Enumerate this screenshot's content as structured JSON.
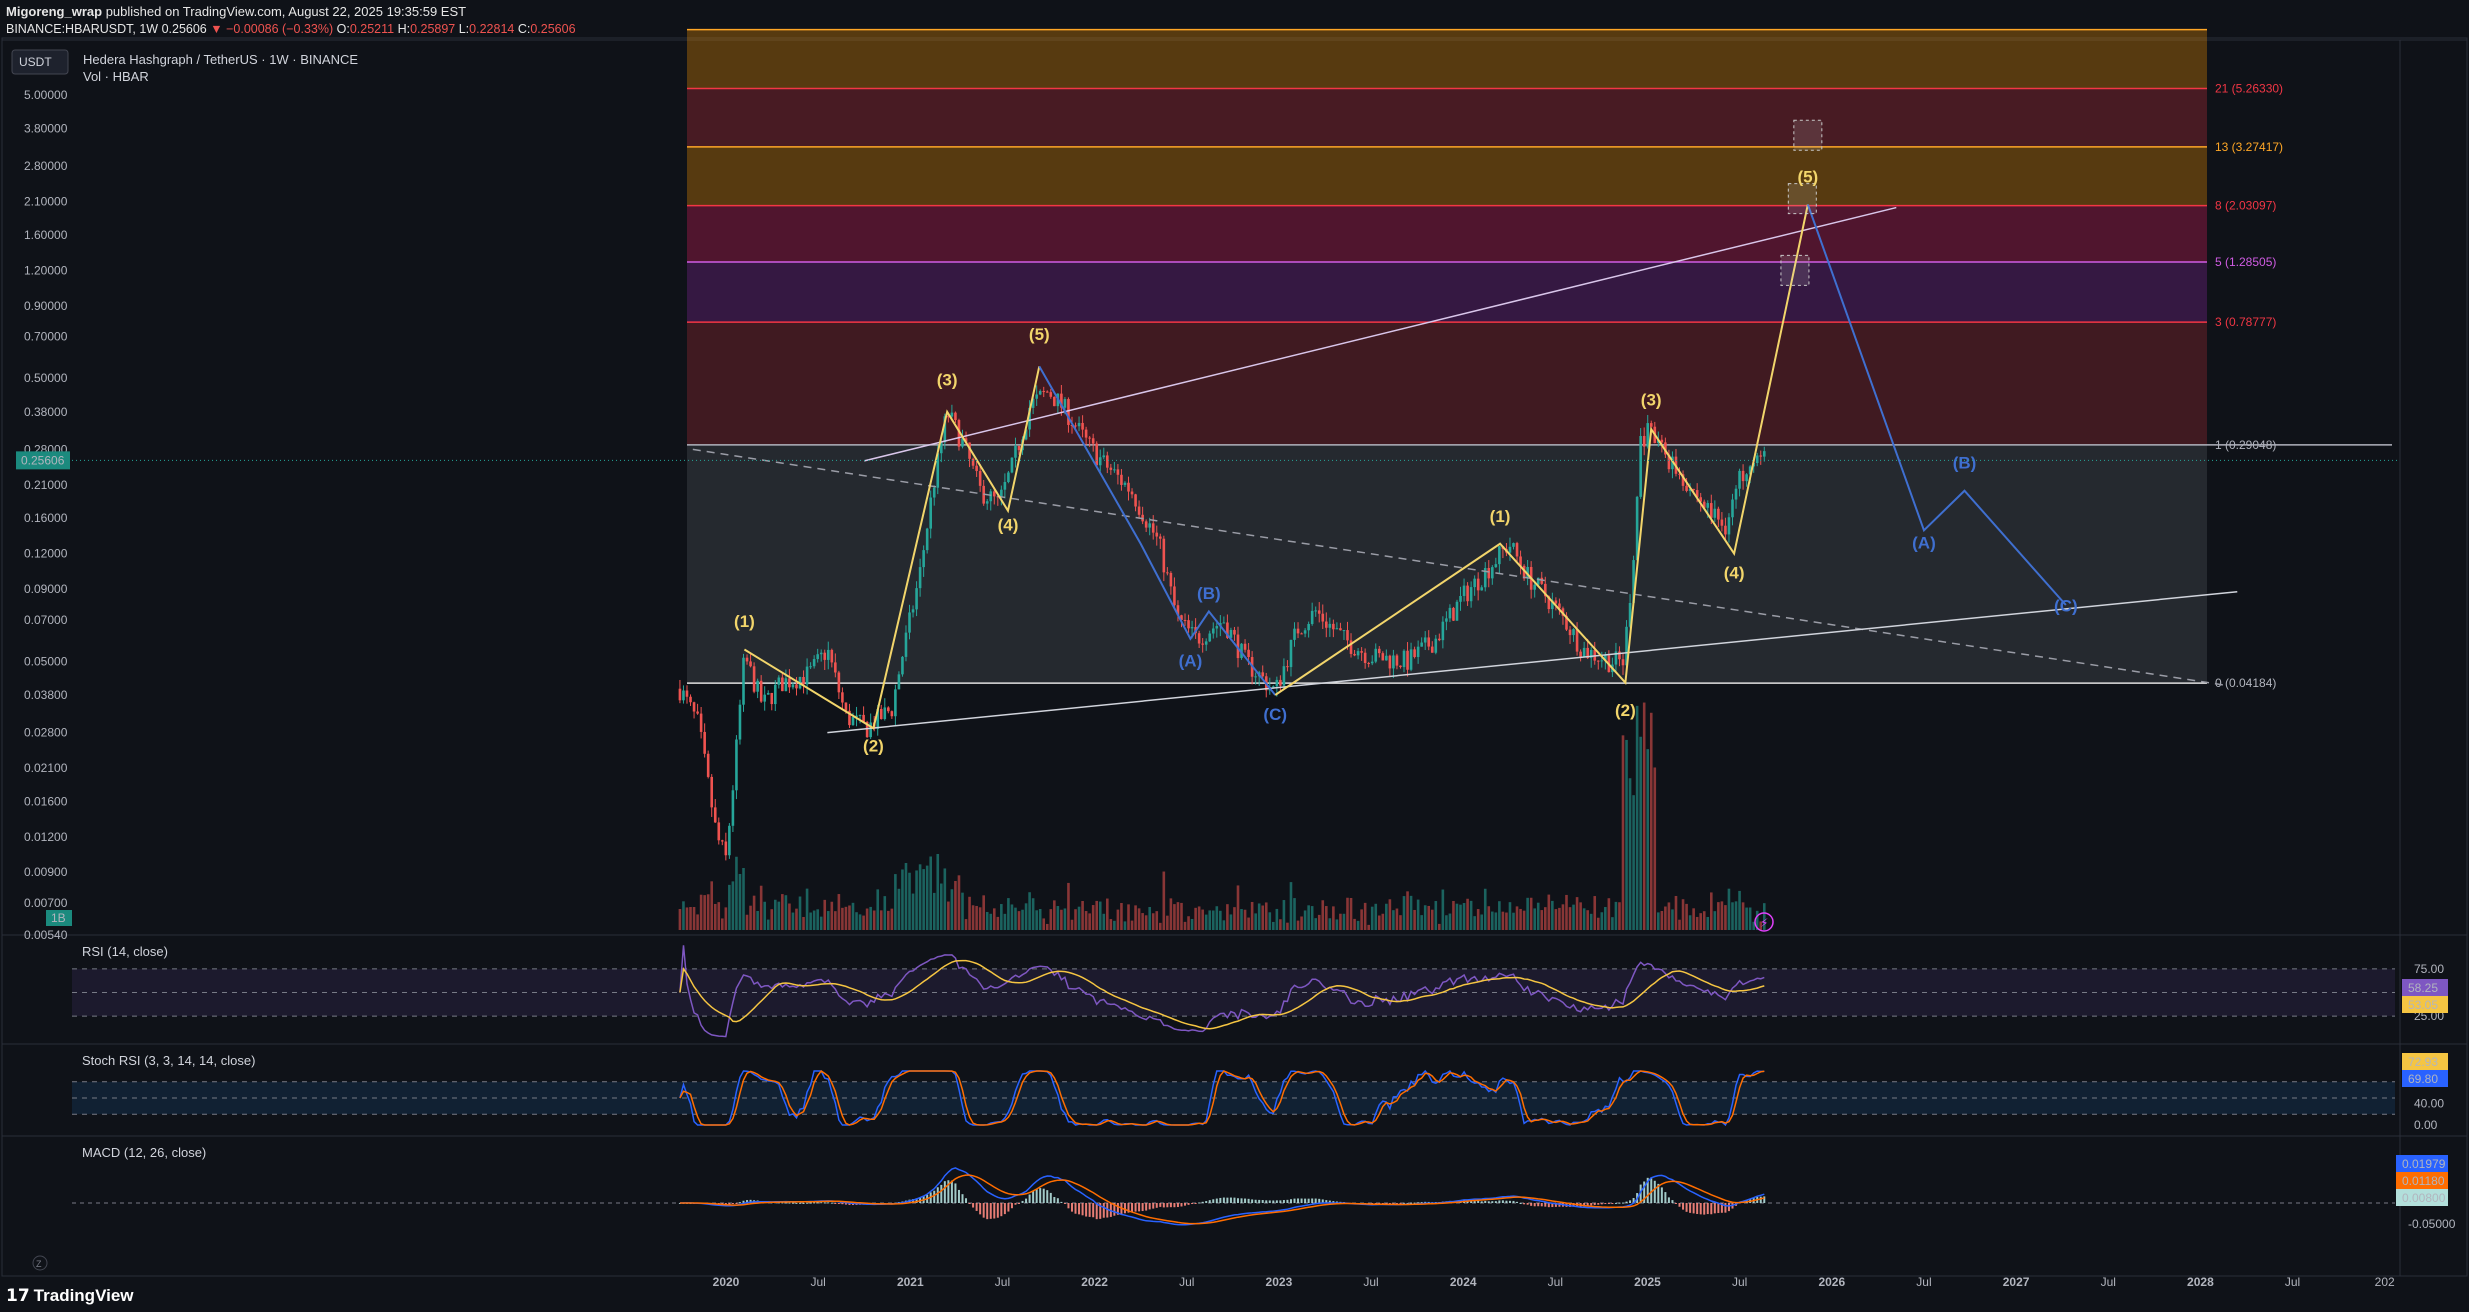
{
  "header": {
    "author": "Migoreng_wrap",
    "published_text": " published on TradingView.com, August 22, 2025 19:35:59 EST",
    "symbol_line": "BINANCE:HBARUSDT, 1W 0.25606",
    "change_text": "▼ −0.00086 (−0.33%)",
    "o_label": "O:",
    "o_value": "0.25211",
    "h_label": "H:",
    "h_value": "0.25897",
    "l_label": "L:",
    "l_value": "0.22814",
    "c_label": "C:",
    "c_value": "0.25606"
  },
  "legend": {
    "currency_button": "USDT",
    "title": "Hedera Hashgraph / TetherUS · 1W · BINANCE",
    "volume_label": "Vol · HBAR",
    "last_price": "0.25606",
    "volume_badge": "1B"
  },
  "footer": {
    "brand": "TradingView",
    "logo": "17"
  },
  "colors": {
    "background": "#0f1218",
    "up": "#26a69a",
    "down": "#ef5350",
    "wave_yellow": "#f2d56b",
    "wave_blue": "#3f6fd0",
    "rsi": "#7e57c2",
    "rsi_ma": "#f5c542",
    "macd": "#2962ff",
    "signal": "#ff6d00"
  },
  "chart_data": [
    {
      "type": "candlestick",
      "title": "Hedera Hashgraph / TetherUS · 1W · BINANCE",
      "y_scale": "log",
      "y_ticks": [
        "5.00000",
        "3.80000",
        "2.80000",
        "2.10000",
        "1.60000",
        "1.20000",
        "0.90000",
        "0.70000",
        "0.50000",
        "0.38000",
        "0.28000",
        "0.21000",
        "0.16000",
        "0.12000",
        "0.09000",
        "0.07000",
        "0.05000",
        "0.03800",
        "0.02800",
        "0.02100",
        "0.01600",
        "0.01200",
        "0.00900",
        "0.00700",
        "0.00540"
      ],
      "x_ticks": [
        "2020",
        "Jul",
        "2021",
        "Jul",
        "2022",
        "Jul",
        "2023",
        "Jul",
        "2024",
        "Jul",
        "2025",
        "Jul",
        "2026",
        "Jul",
        "2027",
        "Jul",
        "2028",
        "Jul",
        "202"
      ],
      "x_tick_dates": [
        2020.0,
        2020.5,
        2021.0,
        2021.5,
        2022.0,
        2022.5,
        2023.0,
        2023.5,
        2024.0,
        2024.5,
        2025.0,
        2025.5,
        2026.0,
        2026.5,
        2027.0,
        2027.5,
        2028.0,
        2028.5,
        2029.0
      ],
      "price_path": [
        [
          2019.75,
          0.04
        ],
        [
          2019.85,
          0.03
        ],
        [
          2019.95,
          0.012
        ],
        [
          2020.0,
          0.01
        ],
        [
          2020.05,
          0.022
        ],
        [
          2020.1,
          0.052
        ],
        [
          2020.2,
          0.035
        ],
        [
          2020.3,
          0.042
        ],
        [
          2020.45,
          0.045
        ],
        [
          2020.55,
          0.055
        ],
        [
          2020.65,
          0.032
        ],
        [
          2020.76,
          0.029
        ],
        [
          2020.9,
          0.034
        ],
        [
          2020.95,
          0.05
        ],
        [
          2021.05,
          0.1
        ],
        [
          2021.12,
          0.2
        ],
        [
          2021.2,
          0.38
        ],
        [
          2021.28,
          0.3
        ],
        [
          2021.38,
          0.2
        ],
        [
          2021.48,
          0.18
        ],
        [
          2021.55,
          0.24
        ],
        [
          2021.65,
          0.4
        ],
        [
          2021.75,
          0.45
        ],
        [
          2021.85,
          0.38
        ],
        [
          2021.95,
          0.3
        ],
        [
          2022.05,
          0.25
        ],
        [
          2022.2,
          0.2
        ],
        [
          2022.35,
          0.13
        ],
        [
          2022.45,
          0.07
        ],
        [
          2022.55,
          0.06
        ],
        [
          2022.7,
          0.07
        ],
        [
          2022.82,
          0.05
        ],
        [
          2022.98,
          0.039
        ],
        [
          2023.1,
          0.065
        ],
        [
          2023.2,
          0.075
        ],
        [
          2023.35,
          0.06
        ],
        [
          2023.5,
          0.052
        ],
        [
          2023.7,
          0.05
        ],
        [
          2023.85,
          0.06
        ],
        [
          2024.0,
          0.085
        ],
        [
          2024.1,
          0.1
        ],
        [
          2024.25,
          0.13
        ],
        [
          2024.35,
          0.1
        ],
        [
          2024.45,
          0.085
        ],
        [
          2024.55,
          0.07
        ],
        [
          2024.65,
          0.055
        ],
        [
          2024.8,
          0.05
        ],
        [
          2024.87,
          0.05
        ],
        [
          2024.92,
          0.1
        ],
        [
          2024.96,
          0.3
        ],
        [
          2025.0,
          0.32
        ],
        [
          2025.08,
          0.28
        ],
        [
          2025.2,
          0.22
        ],
        [
          2025.3,
          0.18
        ],
        [
          2025.42,
          0.15
        ],
        [
          2025.5,
          0.22
        ],
        [
          2025.56,
          0.27
        ],
        [
          2025.64,
          0.256
        ]
      ],
      "last_price": 0.25606,
      "fib_levels": [
        {
          "label": "0 (0.04184)",
          "value": 0.04184
        },
        {
          "label": "1 (0.29048)",
          "value": 0.29048
        },
        {
          "label": "3 (0.78777)",
          "value": 0.78777
        },
        {
          "label": "5 (1.28505)",
          "value": 1.28505
        },
        {
          "label": "8 (2.03097)",
          "value": 2.03097
        },
        {
          "label": "13 (3.27417)",
          "value": 3.27417
        },
        {
          "label": "21 (5.26330)",
          "value": 5.2633
        },
        {
          "label": "",
          "value": 8.5
        }
      ],
      "wave_labels": [
        {
          "text": "(1)",
          "x": 2020.1,
          "y": 0.066,
          "color": "#f2d56b"
        },
        {
          "text": "(2)",
          "x": 2020.8,
          "y": 0.024,
          "color": "#f2d56b"
        },
        {
          "text": "(3)",
          "x": 2021.2,
          "y": 0.47,
          "color": "#f2d56b"
        },
        {
          "text": "(4)",
          "x": 2021.53,
          "y": 0.145,
          "color": "#f2d56b"
        },
        {
          "text": "(5)",
          "x": 2021.7,
          "y": 0.68,
          "color": "#f2d56b"
        },
        {
          "text": "(A)",
          "x": 2022.52,
          "y": 0.048,
          "color": "#3f6fd0"
        },
        {
          "text": "(B)",
          "x": 2022.62,
          "y": 0.083,
          "color": "#3f6fd0"
        },
        {
          "text": "(C)",
          "x": 2022.98,
          "y": 0.031,
          "color": "#3f6fd0"
        },
        {
          "text": "(1)",
          "x": 2024.2,
          "y": 0.155,
          "color": "#f2d56b"
        },
        {
          "text": "(2)",
          "x": 2024.88,
          "y": 0.032,
          "color": "#f2d56b"
        },
        {
          "text": "(3)",
          "x": 2025.02,
          "y": 0.4,
          "color": "#f2d56b"
        },
        {
          "text": "(4)",
          "x": 2025.47,
          "y": 0.098,
          "color": "#f2d56b"
        },
        {
          "text": "(5)",
          "x": 2025.87,
          "y": 2.45,
          "color": "#f2d56b"
        },
        {
          "text": "(A)",
          "x": 2026.5,
          "y": 0.125,
          "color": "#3f6fd0"
        },
        {
          "text": "(B)",
          "x": 2026.72,
          "y": 0.24,
          "color": "#3f6fd0"
        },
        {
          "text": "(C)",
          "x": 2027.27,
          "y": 0.075,
          "color": "#3f6fd0"
        }
      ],
      "impulse_path_1": [
        [
          2020.1,
          0.055
        ],
        [
          2020.8,
          0.029
        ],
        [
          2021.2,
          0.38
        ],
        [
          2021.53,
          0.17
        ],
        [
          2021.7,
          0.55
        ]
      ],
      "correction_path_1": [
        [
          2021.7,
          0.55
        ],
        [
          2022.25,
          0.13
        ],
        [
          2022.52,
          0.06
        ],
        [
          2022.62,
          0.075
        ],
        [
          2022.98,
          0.038
        ]
      ],
      "impulse_path_2": [
        [
          2022.98,
          0.038
        ],
        [
          2024.2,
          0.13
        ],
        [
          2024.88,
          0.042
        ],
        [
          2025.02,
          0.33
        ],
        [
          2025.47,
          0.12
        ],
        [
          2025.87,
          2.05
        ]
      ],
      "projection_path": [
        [
          2025.87,
          2.05
        ],
        [
          2026.5,
          0.145
        ],
        [
          2026.72,
          0.2
        ],
        [
          2027.27,
          0.079
        ]
      ],
      "upper_trendline": [
        [
          2020.75,
          0.255
        ],
        [
          2026.35,
          2.0
        ]
      ],
      "dashed_trendline": [
        [
          2019.82,
          0.28
        ],
        [
          2028.15,
          0.041
        ]
      ],
      "lower_trendline": [
        [
          2020.55,
          0.028
        ],
        [
          2028.2,
          0.088
        ]
      ]
    },
    {
      "type": "line",
      "title": "RSI (14, close)",
      "y_ticks": [
        "75.00",
        "25.00"
      ],
      "rsi_value": "58.25",
      "rsi_ma_value": "53.05"
    },
    {
      "type": "line",
      "title": "Stoch RSI (3, 3, 14, 14, close)",
      "y_ticks": [
        "40.00",
        "0.00"
      ],
      "k_value": "72.93",
      "d_value": "69.80"
    },
    {
      "type": "line",
      "title": "MACD (12, 26, close)",
      "y_ticks": [
        "-0.05000"
      ],
      "macd_value": "0.01979",
      "signal_value": "0.01180",
      "hist_value": "0.00800"
    }
  ]
}
